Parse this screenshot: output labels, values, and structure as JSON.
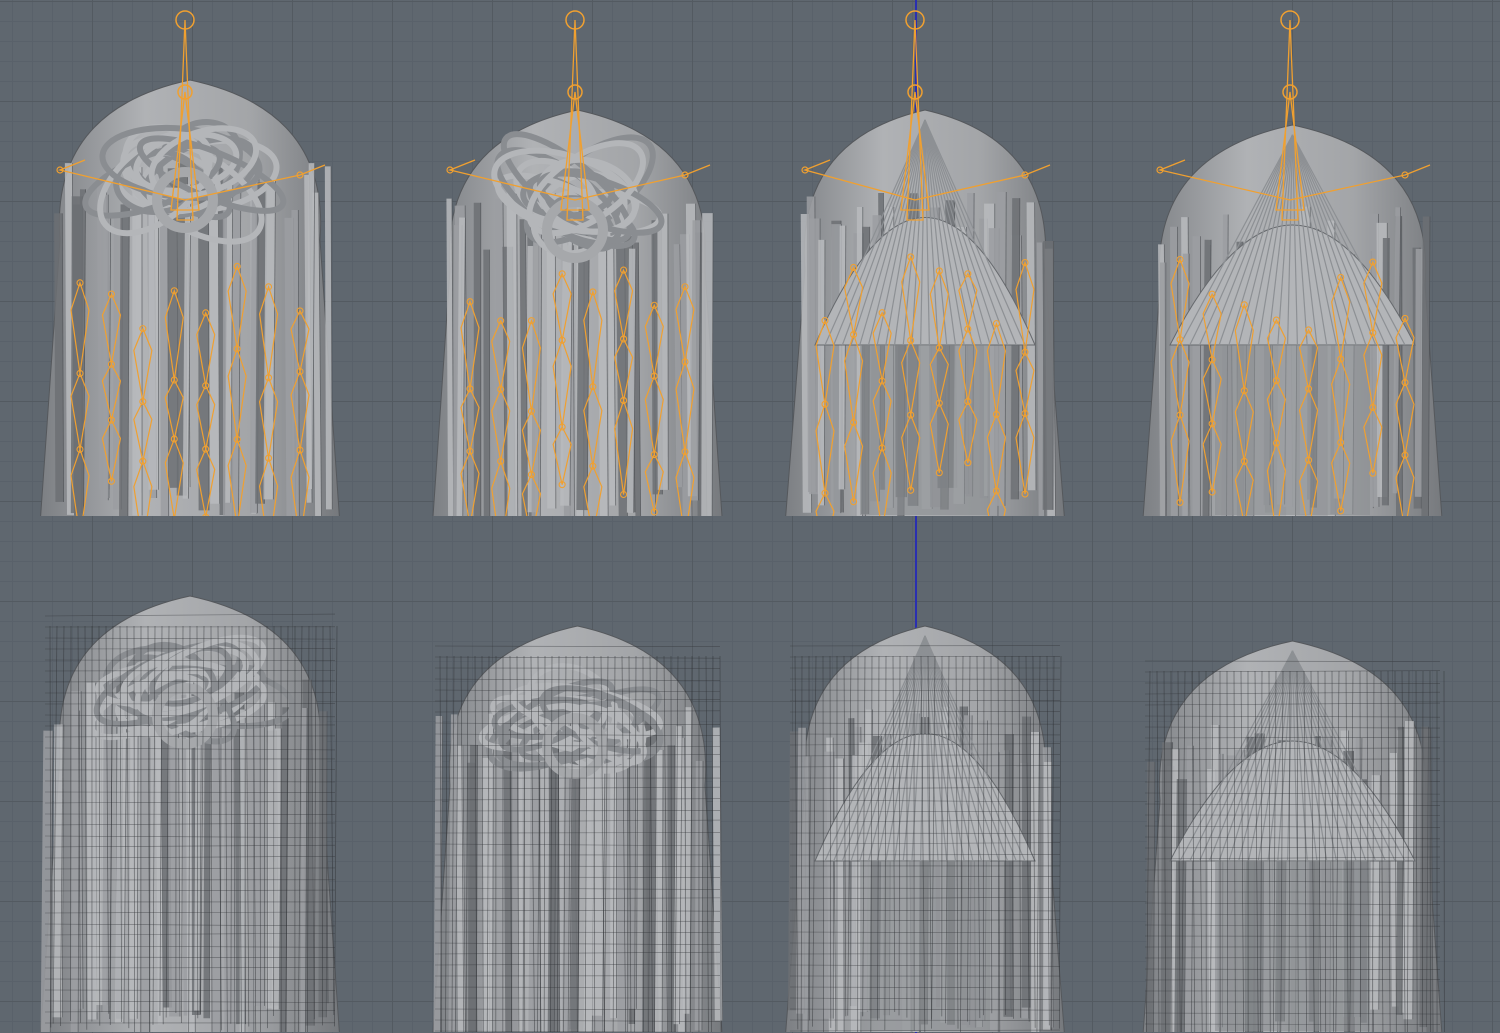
{
  "viewport": {
    "grid": "on",
    "background_color": "#5f676f",
    "grid_color": "#535a61",
    "axis_color": "#2a2fb0"
  },
  "views": [
    {
      "name": "back-view",
      "row": "rigged"
    },
    {
      "name": "three-quarter-back-view",
      "row": "rigged"
    },
    {
      "name": "front-view",
      "row": "rigged"
    },
    {
      "name": "three-quarter-front-view",
      "row": "rigged"
    },
    {
      "name": "back-view",
      "row": "wireframe"
    },
    {
      "name": "three-quarter-back-view",
      "row": "wireframe"
    },
    {
      "name": "front-view",
      "row": "wireframe"
    },
    {
      "name": "three-quarter-front-view",
      "row": "wireframe"
    }
  ],
  "colors": {
    "hair_mesh": "#a7a9ac",
    "hair_shadow": "#6d7074",
    "wire_edges": "#2e3034",
    "bones": "#f0a030"
  }
}
